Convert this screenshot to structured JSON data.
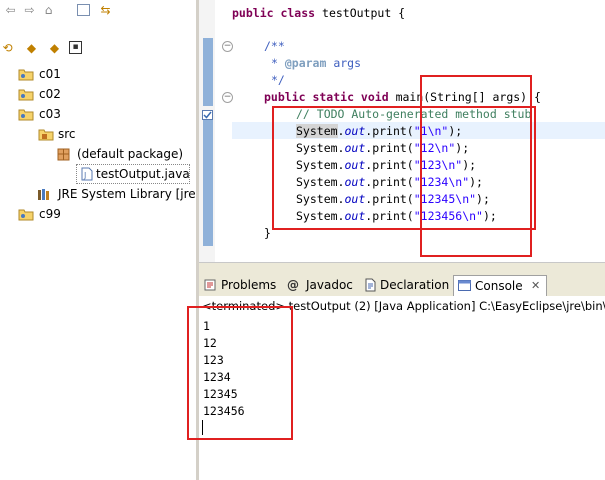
{
  "explorer": {
    "toolbar_icons": [
      "back-icon",
      "forward-icon",
      "home-icon",
      "collapse-all-icon",
      "link-editor-icon"
    ],
    "toolbar2_icons": [
      "sync-icon",
      "go-up-icon",
      "go-into-icon",
      "view-menu-icon"
    ],
    "items": [
      {
        "label": "c01",
        "icon": "folder-project-icon"
      },
      {
        "label": "c02",
        "icon": "folder-project-icon"
      },
      {
        "label": "c03",
        "icon": "folder-project-icon"
      },
      {
        "label": "src",
        "icon": "source-folder-icon"
      },
      {
        "label": "(default package)",
        "icon": "package-icon"
      },
      {
        "label": "testOutput.java",
        "icon": "java-file-icon"
      },
      {
        "label": "JRE System Library [jre]",
        "icon": "library-icon"
      },
      {
        "label": "c99",
        "icon": "folder-project-icon"
      }
    ]
  },
  "editor": {
    "class_line": {
      "kw": "public class ",
      "name": "testOutput {"
    },
    "javadoc_open": "/**",
    "javadoc_param_tag": "@param",
    "javadoc_param_name": " args",
    "javadoc_close": "*/",
    "main_sig": {
      "kw": "public static void ",
      "rest": "main(String[] args) {"
    },
    "todo": "// TODO Auto-generated method stub",
    "print_lines": [
      {
        "obj": "System",
        "fld": "out",
        "call": ".print(",
        "arg": "\"1\\n\"",
        "end": ");"
      },
      {
        "obj": "System",
        "fld": "out",
        "call": ".print(",
        "arg": "\"12\\n\"",
        "end": ");"
      },
      {
        "obj": "System",
        "fld": "out",
        "call": ".print(",
        "arg": "\"123\\n\"",
        "end": ");"
      },
      {
        "obj": "System",
        "fld": "out",
        "call": ".print(",
        "arg": "\"1234\\n\"",
        "end": ");"
      },
      {
        "obj": "System",
        "fld": "out",
        "call": ".print(",
        "arg": "\"12345\\n\"",
        "end": ");"
      },
      {
        "obj": "System",
        "fld": "out",
        "call": ".print(",
        "arg": "\"123456\\n\"",
        "end": ");"
      }
    ],
    "close_brace": "}"
  },
  "tabs": [
    {
      "label": "Problems",
      "icon": "problems-icon"
    },
    {
      "label": "Javadoc",
      "icon": "at-icon"
    },
    {
      "label": "Declaration",
      "icon": "declaration-icon"
    },
    {
      "label": "Console",
      "icon": "console-icon",
      "active": true
    }
  ],
  "console": {
    "terminated": "<terminated> testOutput (2) [Java Application] C:\\EasyEclipse\\jre\\bin\\",
    "output": [
      "1",
      "12",
      "123",
      "1234",
      "12345",
      "123456"
    ]
  }
}
